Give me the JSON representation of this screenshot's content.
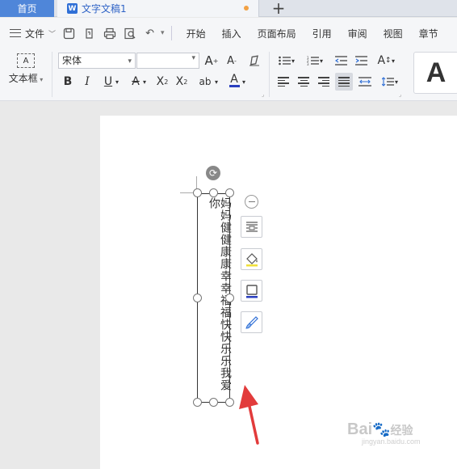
{
  "tabs": {
    "home": "首页",
    "document": "文字文稿1",
    "doc_icon_letter": "W",
    "add": "+"
  },
  "menu": {
    "file": "文件",
    "tabs": [
      "开始",
      "插入",
      "页面布局",
      "引用",
      "审阅",
      "视图",
      "章节"
    ]
  },
  "ribbon": {
    "textbox_label": "文本框",
    "textbox_icon_text": "A",
    "font_name": "宋体",
    "font_size": "",
    "style_preview": "A"
  },
  "textbox": {
    "content": "妈妈健健康康幸幸福福快快乐乐我爱你"
  },
  "watermark": {
    "brand": "Bai",
    "paw": "🐾",
    "suffix": "经验",
    "url": "jingyan.baidu.com"
  },
  "colors": {
    "accent": "#4f86d9",
    "arrow": "#e23b3b",
    "font_color_bar": "#2a3fbf",
    "highlight_bar": "#f0e03a"
  }
}
